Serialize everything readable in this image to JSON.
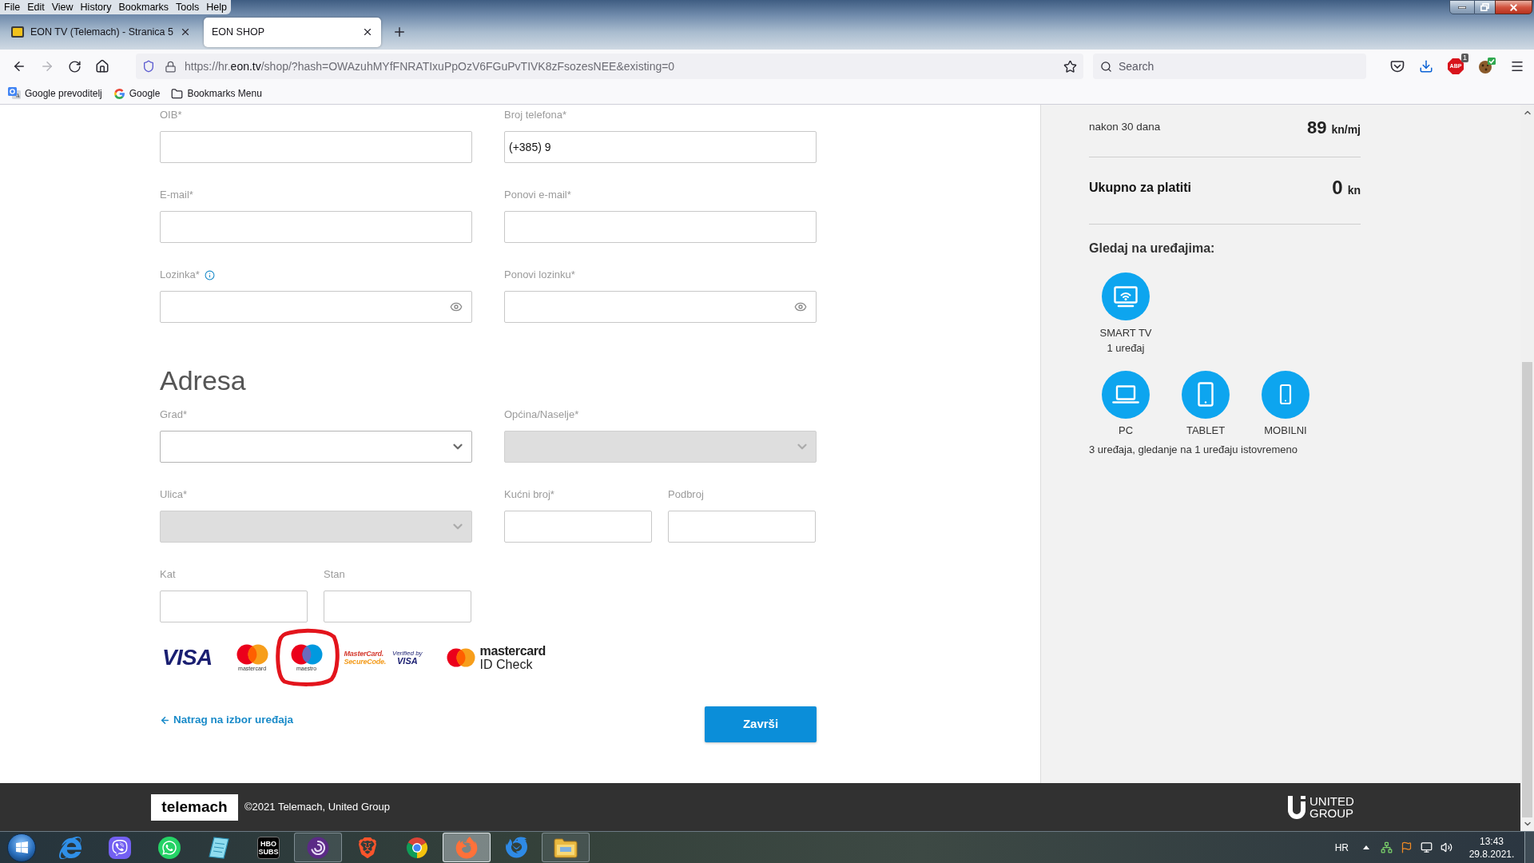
{
  "browser": {
    "menu": [
      "File",
      "Edit",
      "View",
      "History",
      "Bookmarks",
      "Tools",
      "Help"
    ],
    "tabs": [
      {
        "title": "EON TV (Telemach) - Stranica 5",
        "icon": true,
        "selected": false
      },
      {
        "title": "EON SHOP",
        "icon": false,
        "selected": true
      }
    ],
    "nav_buttons": [
      {
        "kind": "back",
        "disabled": false
      },
      {
        "kind": "forward",
        "disabled": true
      },
      {
        "kind": "reload",
        "disabled": false
      },
      {
        "kind": "home",
        "disabled": false
      }
    ],
    "url": {
      "prefix": "https://hr.",
      "domain": "eon.tv",
      "path": "/shop/?hash=OWAzuhMYfFNRATIxuPpOzV6FGuPvTIVK8zFsozesNEE&existing=0"
    },
    "search": {
      "placeholder": "Search"
    },
    "adblock": {
      "label": "ABP",
      "badge": "1"
    },
    "bookmarks": [
      {
        "kind": "translate",
        "label": "Google prevoditelj"
      },
      {
        "kind": "google",
        "label": "Google"
      },
      {
        "kind": "folder",
        "label": "Bookmarks Menu"
      }
    ]
  },
  "form": {
    "sections": [
      {
        "kind": "personal",
        "rows": [
          [
            {
              "kind": "text",
              "label": "OIB*"
            },
            {
              "kind": "text",
              "label": "Broj telefona*",
              "value": "(+385) 9"
            }
          ],
          [
            {
              "kind": "text",
              "label": "E-mail*"
            },
            {
              "kind": "text",
              "label": "Ponovi e-mail*"
            }
          ],
          [
            {
              "kind": "password",
              "label": "Lozinka*",
              "info": true
            },
            {
              "kind": "password",
              "label": "Ponovi lozinku*",
              "info": false
            }
          ]
        ]
      },
      {
        "kind": "address",
        "title": "Adresa",
        "rows": [
          [
            {
              "kind": "select",
              "label": "Grad*",
              "disabled": false
            },
            {
              "kind": "select",
              "label": "Općina/Naselje*",
              "disabled": true
            }
          ],
          [
            {
              "kind": "select",
              "label": "Ulica*",
              "disabled": true
            },
            {
              "kind": "text",
              "label": "Kućni broj*"
            },
            {
              "kind": "text",
              "label": "Podbroj"
            }
          ],
          [
            {
              "kind": "text",
              "label": "Kat"
            },
            {
              "kind": "text",
              "label": "Stan"
            }
          ]
        ]
      }
    ],
    "payment_logos": [
      {
        "kind": "visa",
        "text": "VISA",
        "circled": false
      },
      {
        "kind": "mastercard",
        "text": "mastercard",
        "circled": false
      },
      {
        "kind": "maestro",
        "text": "maestro",
        "circled": true
      },
      {
        "kind": "securecode",
        "text": "MasterCard.",
        "subtext": "SecureCode.",
        "circled": false
      },
      {
        "kind": "verified",
        "text": "Verified by",
        "subtext": "VISA",
        "circled": false
      },
      {
        "kind": "idcheck",
        "text": "mastercard",
        "subtext": "ID Check",
        "circled": false
      }
    ],
    "back_link": "Natrag na izbor uređaja",
    "submit_button": "Završi"
  },
  "summary": {
    "rows": [
      {
        "kind": "price",
        "label": "nakon 30 dana",
        "amount": "89",
        "unit": "kn/mj"
      },
      {
        "kind": "total",
        "label": "Ukupno za platiti",
        "amount": "0",
        "unit": "kn"
      }
    ],
    "devices_title": "Gledaj na uređajima:",
    "device_groups": [
      {
        "devices": [
          {
            "kind": "tv",
            "label": "SMART TV"
          }
        ],
        "note": "1 uređaj"
      },
      {
        "devices": [
          {
            "kind": "laptop",
            "label": "PC"
          },
          {
            "kind": "tablet",
            "label": "TABLET"
          },
          {
            "kind": "phone",
            "label": "MOBILNI"
          }
        ],
        "note": "3 uređaja, gledanje na 1 uređaju istovremeno"
      }
    ]
  },
  "footer": {
    "brand": "telemach",
    "copyright": "©2021 Telemach, United Group",
    "group_logo": "UNITED GROUP"
  },
  "taskbar": {
    "apps": [
      {
        "kind": "ie",
        "running": false,
        "selected": false
      },
      {
        "kind": "viber",
        "running": false,
        "selected": false
      },
      {
        "kind": "whatsapp",
        "running": false,
        "selected": false
      },
      {
        "kind": "notes",
        "running": false,
        "selected": false
      },
      {
        "kind": "hbo",
        "label": "HBO SUBS",
        "running": false,
        "selected": false
      },
      {
        "kind": "swirl",
        "running": true,
        "selected": false
      },
      {
        "kind": "brave",
        "running": false,
        "selected": false
      },
      {
        "kind": "chrome",
        "running": false,
        "selected": false
      },
      {
        "kind": "firefox",
        "running": true,
        "selected": true
      },
      {
        "kind": "mail",
        "running": false,
        "selected": false
      },
      {
        "kind": "folder",
        "running": true,
        "selected": false
      }
    ],
    "language": "HR",
    "time": "13:43",
    "date": "29.8.2021."
  }
}
